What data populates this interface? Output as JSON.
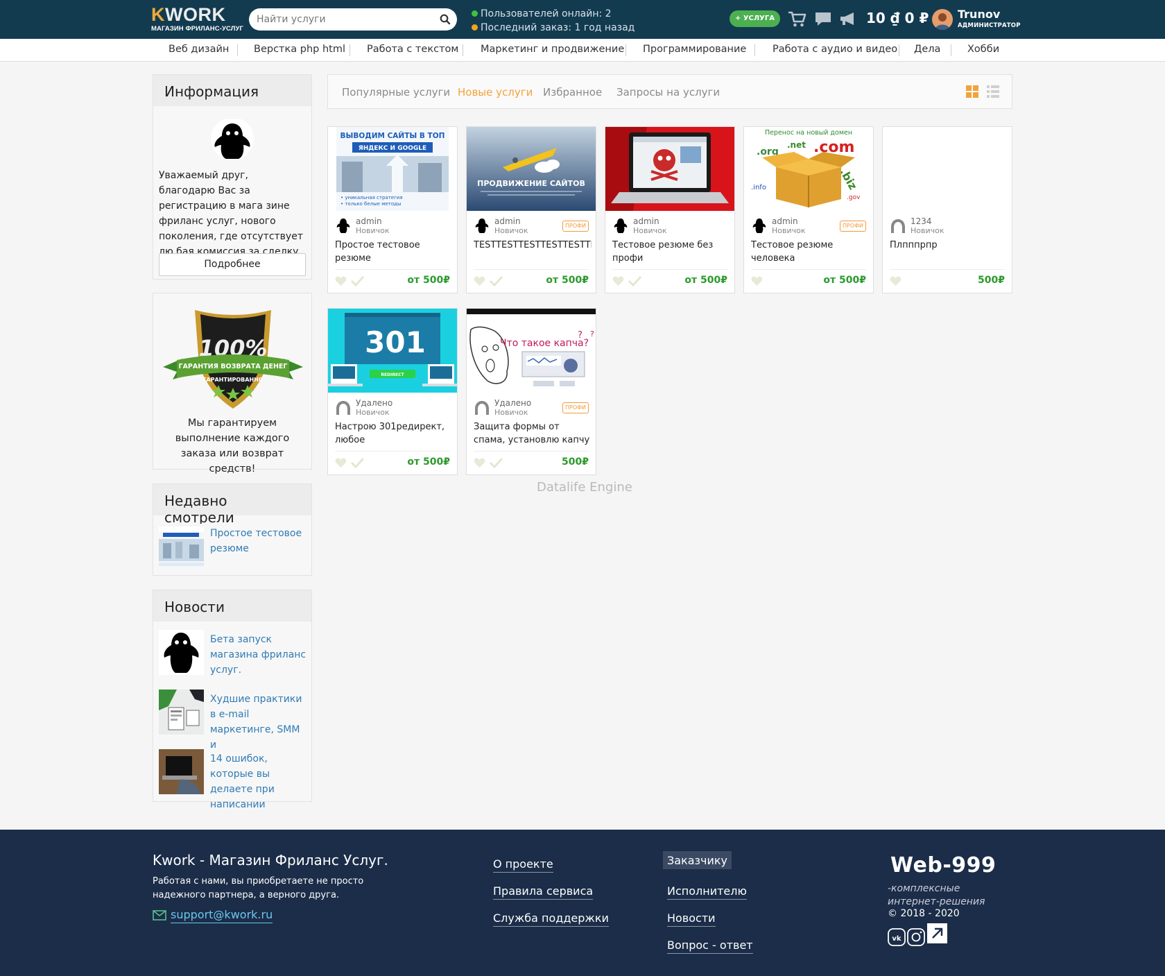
{
  "header": {
    "logo_text": "KWORK",
    "logo_subtitle": "МАГАЗИН ФРИЛАНС-УСЛУГ",
    "search_placeholder": "Найти услуги",
    "online_users": "Пользователей онлайн: 2",
    "last_order": "Последний заказ: 1 год назад",
    "add_service_label": "+ УСЛУГА",
    "balance": "10 ₫ 0 ₽",
    "user_name": "Trunov",
    "user_role": "АДМИНИСТРАТОР"
  },
  "categories": [
    "Веб дизайн",
    "Верстка php html",
    "Работа с текстом",
    "Маркетинг и продвижение",
    "Программирование",
    "Работа с аудио и видео",
    "Дела",
    "Хобби"
  ],
  "sidebar": {
    "info": {
      "title": "Информация",
      "text": "Уважаемый друг, благодарю Вас за регистрацию в мага зине фриланс услуг, нового поколения, где отсутствует лю бая комиссия за сделку.",
      "button": "Подробнее"
    },
    "guarantee": {
      "badge_percent": "100%",
      "badge_ribbon": "ГАРАНТИЯ ВОЗВРАТА ДЕНЕГ",
      "badge_sub": "ГАРАНТИРОВАННО",
      "text": "Мы гарантируем выполнение каждого заказа или возврат средств!"
    },
    "recent": {
      "title": "Недавно смотрели",
      "items": [
        {
          "title": "Простое тестовое резюме"
        }
      ]
    },
    "news": {
      "title": "Новости",
      "items": [
        {
          "title": "Бета запуск магазина фриланс услуг."
        },
        {
          "title": "Худшие практики в e-mail маркетинге, SMM и"
        },
        {
          "title": "14 ошибок, которые вы делаете при написании"
        }
      ]
    }
  },
  "tabs": [
    "Популярные услуги",
    "Новые услуги",
    "Избранное",
    "Запросы на услуги"
  ],
  "active_tab": "Новые услуги",
  "badge_label": "ПРОФИ",
  "cards": [
    {
      "user": "admin",
      "level": "Новичок",
      "title": "Простое тестовое резюме",
      "price": "от 500₽",
      "profi": false,
      "checked": true,
      "img_text": "ВЫВОДИМ САЙТЫ В ТОП",
      "img_sub": "ЯНДЕКС И GOOGLE"
    },
    {
      "user": "admin",
      "level": "Новичок",
      "title": "TESTTESTTESTTESTTESTTES",
      "price": "от 500₽",
      "profi": true,
      "checked": true,
      "img_text": "ПРОДВИЖЕНИЕ САЙТОВ"
    },
    {
      "user": "admin",
      "level": "Новичок",
      "title": "Тестовое резюме без профи",
      "price": "от 500₽",
      "profi": false,
      "checked": true
    },
    {
      "user": "admin",
      "level": "Новичок",
      "title": "Тестовое резюме человека",
      "price": "от 500₽",
      "profi": true,
      "checked": false,
      "img_text": "Перенос на новый домен"
    },
    {
      "user": "1234",
      "level": "Новичок",
      "title": "Плпппрпр",
      "price": "500₽",
      "profi": false,
      "checked": false
    },
    {
      "user": "Удалено",
      "level": "Новичок",
      "title": "Настрою 301редирект, любое",
      "price": "от 500₽",
      "profi": false,
      "checked": true,
      "img_text": "301",
      "img_sub": "REDIRECT"
    },
    {
      "user": "Удалено",
      "level": "Новичок",
      "title": "Защита формы от спама, установлю капчу на",
      "price": "500₽",
      "profi": true,
      "checked": true,
      "img_text": "Что такое капча?"
    }
  ],
  "engine": "Datalife Engine",
  "footer": {
    "title": "Kwork - Магазин Фриланс Услуг.",
    "desc": "Работая с нами, вы приобретаете не просто надежного партнера, а верного друга.",
    "email": "support@kwork.ru",
    "links_col1": [
      "О проекте",
      "Правила сервиса",
      "Служба поддержки"
    ],
    "links_col2": [
      "Заказчику",
      "Исполнителю",
      "Новости",
      "Вопрос - ответ"
    ],
    "brand": "Web-999",
    "brand_sub": "-комплексные интернет-решения",
    "copyright": "© 2018 - 2020"
  },
  "colors": {
    "header_bg": "#123b50",
    "accent_orange": "#f2a33a",
    "price_green": "#2c9a2c",
    "link_blue": "#2f7bb5",
    "footer_bg": "#1b2d48"
  }
}
